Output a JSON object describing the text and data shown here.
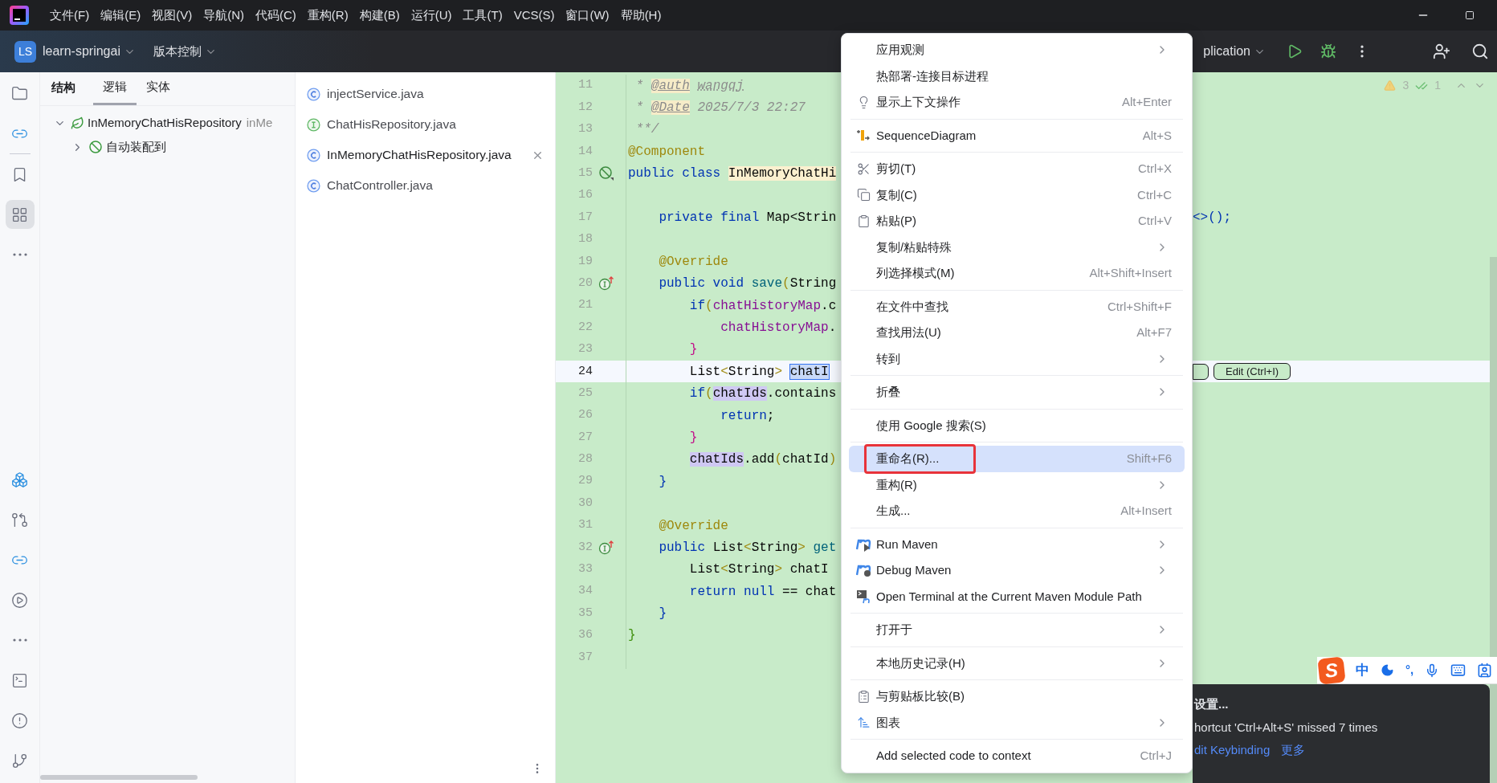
{
  "menu_bar": {
    "items": [
      "文件(F)",
      "编辑(E)",
      "视图(V)",
      "导航(N)",
      "代码(C)",
      "重构(R)",
      "构建(B)",
      "运行(U)",
      "工具(T)",
      "VCS(S)",
      "窗口(W)",
      "帮助(H)"
    ]
  },
  "toolbar": {
    "project_badge": "LS",
    "project": "learn-springai",
    "vcs": "版本控制",
    "run_config": "plication"
  },
  "left_toolbar": {
    "top": [
      {
        "selected": false
      },
      {
        "selected": false
      },
      {
        "selected": false
      },
      {
        "selected": true
      },
      {
        "selected": false
      }
    ],
    "bottom": [
      {
        "selected": false
      },
      {
        "selected": false
      },
      {
        "selected": false
      },
      {
        "selected": false
      },
      {
        "selected": false
      },
      {
        "selected": false
      },
      {
        "selected": false
      },
      {
        "selected": false
      }
    ]
  },
  "structure": {
    "title": "结构",
    "tabs": [
      {
        "label": "逻辑",
        "selected": true
      },
      {
        "label": "实体",
        "selected": false
      }
    ],
    "tree": [
      {
        "label": "InMemoryChatHisRepository",
        "hint": "inMe",
        "expanded": true,
        "children": [
          {
            "label": "自动装配到",
            "expanded": false
          }
        ]
      }
    ]
  },
  "files": [
    {
      "name": "injectService.java",
      "kind": "class",
      "selected": false
    },
    {
      "name": "ChatHisRepository.java",
      "kind": "interface",
      "selected": false
    },
    {
      "name": "InMemoryChatHisRepository.java",
      "kind": "class",
      "selected": true
    },
    {
      "name": "ChatController.java",
      "kind": "class",
      "selected": false
    }
  ],
  "editor": {
    "warnings": "3",
    "checks": "1",
    "inline_button": "Edit (Ctrl+I)",
    "lines": [
      {
        "number": "11",
        "current": false,
        "tokens": [
          {
            "kind": "comment",
            "text": " * "
          },
          {
            "kind": "doctag",
            "text": "@auth"
          },
          {
            "kind": "typo",
            "text": " wangqj"
          }
        ]
      },
      {
        "number": "12",
        "current": false,
        "tokens": [
          {
            "kind": "comment",
            "text": " * "
          },
          {
            "kind": "doctag",
            "text": "@Date"
          },
          {
            "kind": "comment",
            "text": " 2025/7/3 22:27"
          }
        ]
      },
      {
        "number": "13",
        "current": false,
        "tokens": [
          {
            "kind": "comment",
            "text": " **/"
          }
        ]
      },
      {
        "number": "14",
        "current": false,
        "tokens": [
          {
            "kind": "ann",
            "text": "@Component"
          }
        ]
      },
      {
        "number": "15",
        "current": false,
        "gutter": {
          "kind": "bean"
        },
        "tokens": [
          {
            "kind": "kw",
            "text": "public class "
          },
          {
            "kind": "decl",
            "text": "InMemoryChatHi"
          }
        ]
      },
      {
        "number": "16",
        "current": false
      },
      {
        "number": "17",
        "current": false,
        "tokens": [
          {
            "kind": "kw",
            "text": "    private final "
          },
          {
            "kind": "plain",
            "text": "Map<Strin"
          }
        ],
        "tail": "<>();"
      },
      {
        "number": "18",
        "current": false
      },
      {
        "number": "19",
        "current": false,
        "tokens": [
          {
            "kind": "ann",
            "text": "    @Override"
          }
        ]
      },
      {
        "number": "20",
        "current": false,
        "gutter": {
          "kind": "implements"
        },
        "tokens": [
          {
            "kind": "kw",
            "text": "    public void "
          },
          {
            "kind": "fn",
            "text": "save"
          },
          {
            "kind": "p1",
            "text": "("
          },
          {
            "kind": "plain",
            "text": "String"
          }
        ]
      },
      {
        "number": "21",
        "current": false,
        "tokens": [
          {
            "kind": "kw",
            "text": "        if"
          },
          {
            "kind": "p1",
            "text": "("
          },
          {
            "kind": "field",
            "text": "chatHistoryMap"
          },
          {
            "kind": "plain",
            "text": ".c"
          }
        ]
      },
      {
        "number": "22",
        "current": false,
        "tokens": [
          {
            "kind": "field",
            "text": "            chatHistoryMap"
          },
          {
            "kind": "plain",
            "text": "."
          }
        ]
      },
      {
        "number": "23",
        "current": false,
        "tokens": [
          {
            "kind": "p2",
            "text": "        }"
          }
        ]
      },
      {
        "number": "24",
        "current": true,
        "tokens": [
          {
            "kind": "plain",
            "text": "        List"
          },
          {
            "kind": "p1",
            "text": "<"
          },
          {
            "kind": "plain",
            "text": "String"
          },
          {
            "kind": "p1",
            "text": ">"
          },
          {
            "kind": "sel",
            "text": " chatI"
          }
        ]
      },
      {
        "number": "25",
        "current": false,
        "tokens": [
          {
            "kind": "kw",
            "text": "        if"
          },
          {
            "kind": "p1",
            "text": "("
          },
          {
            "kind": "usage",
            "text": "chatIds"
          },
          {
            "kind": "plain",
            "text": ".contains"
          }
        ]
      },
      {
        "number": "26",
        "current": false,
        "tokens": [
          {
            "kind": "kw",
            "text": "            return"
          },
          {
            "kind": "plain",
            "text": ";"
          }
        ]
      },
      {
        "number": "27",
        "current": false,
        "tokens": [
          {
            "kind": "p2",
            "text": "        }"
          }
        ]
      },
      {
        "number": "28",
        "current": false,
        "tokens": [
          {
            "kind": "usage",
            "text": "        chatIds"
          },
          {
            "kind": "plain",
            "text": ".add"
          },
          {
            "kind": "p1",
            "text": "("
          },
          {
            "kind": "plain",
            "text": "chatId"
          },
          {
            "kind": "p1",
            "text": ")"
          }
        ]
      },
      {
        "number": "29",
        "current": false,
        "tokens": [
          {
            "kind": "kw",
            "text": "    }"
          }
        ]
      },
      {
        "number": "30",
        "current": false
      },
      {
        "number": "31",
        "current": false,
        "tokens": [
          {
            "kind": "ann",
            "text": "    @Override"
          }
        ]
      },
      {
        "number": "32",
        "current": false,
        "gutter": {
          "kind": "implements"
        },
        "tokens": [
          {
            "kind": "kw",
            "text": "    public "
          },
          {
            "kind": "plain",
            "text": "List"
          },
          {
            "kind": "p1",
            "text": "<"
          },
          {
            "kind": "plain",
            "text": "String"
          },
          {
            "kind": "p1",
            "text": ">"
          },
          {
            "kind": "fn",
            "text": " get"
          }
        ]
      },
      {
        "number": "33",
        "current": false,
        "tokens": [
          {
            "kind": "plain",
            "text": "        List"
          },
          {
            "kind": "p1",
            "text": "<"
          },
          {
            "kind": "plain",
            "text": "String"
          },
          {
            "kind": "p1",
            "text": ">"
          },
          {
            "kind": "plain",
            "text": " chatI"
          }
        ]
      },
      {
        "number": "34",
        "current": false,
        "tokens": [
          {
            "kind": "kw",
            "text": "        return null "
          },
          {
            "kind": "plain",
            "text": "== chat"
          }
        ]
      },
      {
        "number": "35",
        "current": false,
        "tokens": [
          {
            "kind": "kw",
            "text": "    }"
          }
        ]
      },
      {
        "number": "36",
        "current": false,
        "tokens": [
          {
            "kind": "cls",
            "text": "}"
          }
        ]
      },
      {
        "number": "37",
        "current": false
      }
    ]
  },
  "context_menu": {
    "items": [
      {
        "kind": "item",
        "label": "应用观测",
        "submenu": true,
        "selected": false,
        "outlined": false
      },
      {
        "kind": "item",
        "label": "热部署-连接目标进程",
        "submenu": false,
        "selected": false,
        "outlined": false
      },
      {
        "kind": "item",
        "label": "显示上下文操作",
        "shortcut": "Alt+Enter",
        "submenu": false,
        "selected": false,
        "outlined": false
      },
      {
        "kind": "separator"
      },
      {
        "kind": "item",
        "label": "SequenceDiagram",
        "shortcut": "Alt+S",
        "submenu": false,
        "selected": false,
        "outlined": false
      },
      {
        "kind": "separator"
      },
      {
        "kind": "item",
        "label": "剪切(T)",
        "shortcut": "Ctrl+X",
        "submenu": false,
        "selected": false,
        "outlined": false
      },
      {
        "kind": "item",
        "label": "复制(C)",
        "shortcut": "Ctrl+C",
        "submenu": false,
        "selected": false,
        "outlined": false
      },
      {
        "kind": "item",
        "label": "粘贴(P)",
        "shortcut": "Ctrl+V",
        "submenu": false,
        "selected": false,
        "outlined": false
      },
      {
        "kind": "item",
        "label": "复制/粘贴特殊",
        "submenu": true,
        "selected": false,
        "outlined": false
      },
      {
        "kind": "item",
        "label": "列选择模式(M)",
        "shortcut": "Alt+Shift+Insert",
        "submenu": false,
        "selected": false,
        "outlined": false
      },
      {
        "kind": "separator"
      },
      {
        "kind": "item",
        "label": "在文件中查找",
        "shortcut": "Ctrl+Shift+F",
        "submenu": false,
        "selected": false,
        "outlined": false
      },
      {
        "kind": "item",
        "label": "查找用法(U)",
        "shortcut": "Alt+F7",
        "submenu": false,
        "selected": false,
        "outlined": false
      },
      {
        "kind": "item",
        "label": "转到",
        "submenu": true,
        "selected": false,
        "outlined": false
      },
      {
        "kind": "separator"
      },
      {
        "kind": "item",
        "label": "折叠",
        "submenu": true,
        "selected": false,
        "outlined": false
      },
      {
        "kind": "separator"
      },
      {
        "kind": "item",
        "label": "使用 Google 搜索(S)",
        "submenu": false,
        "selected": false,
        "outlined": false
      },
      {
        "kind": "separator"
      },
      {
        "kind": "item",
        "label": "重命名(R)...",
        "shortcut": "Shift+F6",
        "submenu": false,
        "selected": true,
        "outlined": true
      },
      {
        "kind": "item",
        "label": "重构(R)",
        "submenu": true,
        "selected": false,
        "outlined": false
      },
      {
        "kind": "item",
        "label": "生成...",
        "shortcut": "Alt+Insert",
        "submenu": false,
        "selected": false,
        "outlined": false
      },
      {
        "kind": "separator"
      },
      {
        "kind": "item",
        "label": "Run Maven",
        "submenu": true,
        "selected": false,
        "outlined": false
      },
      {
        "kind": "item",
        "label": "Debug Maven",
        "submenu": true,
        "selected": false,
        "outlined": false
      },
      {
        "kind": "item",
        "label": "Open Terminal at the Current Maven Module Path",
        "submenu": false,
        "selected": false,
        "outlined": false
      },
      {
        "kind": "separator"
      },
      {
        "kind": "item",
        "label": "打开于",
        "submenu": true,
        "selected": false,
        "outlined": false
      },
      {
        "kind": "separator"
      },
      {
        "kind": "item",
        "label": "本地历史记录(H)",
        "submenu": true,
        "selected": false,
        "outlined": false
      },
      {
        "kind": "separator"
      },
      {
        "kind": "item",
        "label": "与剪贴板比较(B)",
        "submenu": false,
        "selected": false,
        "outlined": false
      },
      {
        "kind": "item",
        "label": "图表",
        "submenu": true,
        "selected": false,
        "outlined": false
      },
      {
        "kind": "separator"
      },
      {
        "kind": "item",
        "label": "Add selected code to context",
        "shortcut": "Ctrl+J",
        "submenu": false,
        "selected": false,
        "outlined": false
      }
    ]
  },
  "notification": {
    "title": "设置...",
    "message": "hortcut 'Ctrl+Alt+S' missed 7 times",
    "links": [
      "dit Keybinding",
      "更多"
    ]
  },
  "ime_bar": {
    "logo": "S",
    "mode": "中",
    "punct": "°,"
  }
}
